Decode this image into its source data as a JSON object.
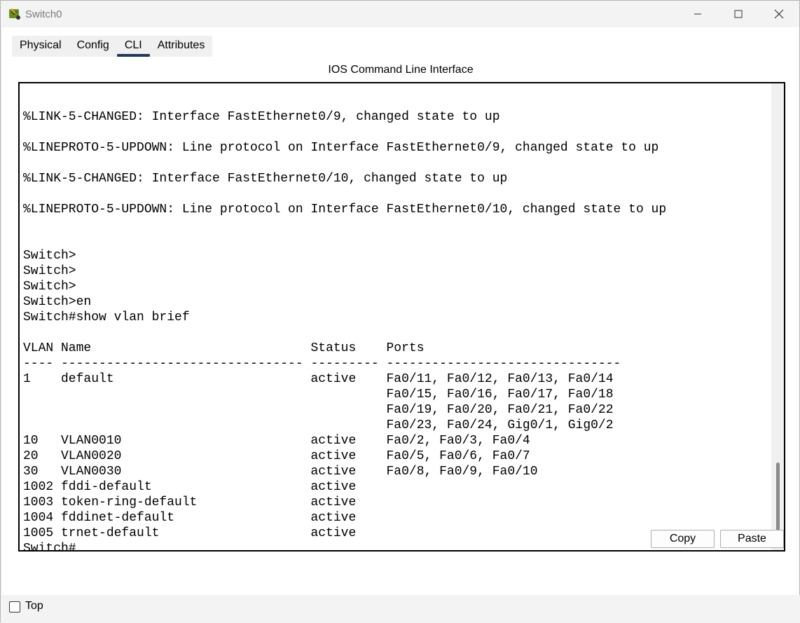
{
  "window": {
    "title": "Switch0"
  },
  "tabs": [
    {
      "label": "Physical"
    },
    {
      "label": "Config"
    },
    {
      "label": "CLI"
    },
    {
      "label": "Attributes"
    }
  ],
  "cli": {
    "heading": "IOS Command Line Interface",
    "lines": [
      "",
      "",
      "%LINK-5-CHANGED: Interface FastEthernet0/9, changed state to up",
      "",
      "%LINEPROTO-5-UPDOWN: Line protocol on Interface FastEthernet0/9, changed state to up",
      "",
      "%LINK-5-CHANGED: Interface FastEthernet0/10, changed state to up",
      "",
      "%LINEPROTO-5-UPDOWN: Line protocol on Interface FastEthernet0/10, changed state to up",
      "",
      "",
      "Switch>",
      "Switch>",
      "Switch>",
      "Switch>en",
      "Switch#show vlan brief",
      "",
      "VLAN Name                             Status    Ports",
      "---- -------------------------------- --------- -------------------------------",
      "1    default                          active    Fa0/11, Fa0/12, Fa0/13, Fa0/14",
      "                                                Fa0/15, Fa0/16, Fa0/17, Fa0/18",
      "                                                Fa0/19, Fa0/20, Fa0/21, Fa0/22",
      "                                                Fa0/23, Fa0/24, Gig0/1, Gig0/2",
      "10   VLAN0010                         active    Fa0/2, Fa0/3, Fa0/4",
      "20   VLAN0020                         active    Fa0/5, Fa0/6, Fa0/7",
      "30   VLAN0030                         active    Fa0/8, Fa0/9, Fa0/10",
      "1002 fddi-default                     active    ",
      "1003 token-ring-default               active    ",
      "1004 fddinet-default                  active    ",
      "1005 trnet-default                    active    ",
      "Switch#"
    ]
  },
  "buttons": {
    "copy": "Copy",
    "paste": "Paste"
  },
  "footer": {
    "top_label": "Top",
    "top_checked": false
  }
}
